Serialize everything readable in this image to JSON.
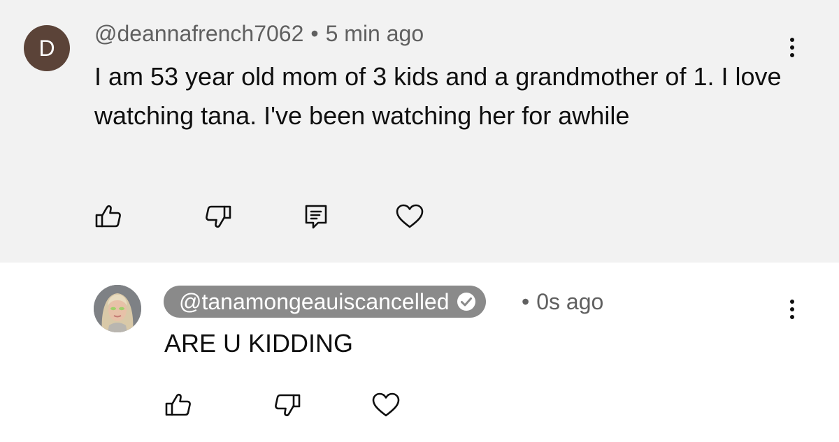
{
  "comment": {
    "avatar_letter": "D",
    "avatar_color": "#5b4338",
    "handle": "@deannafrench7062",
    "separator": "•",
    "time": "5 min ago",
    "text": "I am 53 year old mom of 3 kids and a grandmother of 1. I love watching tana. I've been watching her for awhile",
    "actions": [
      "like-icon",
      "dislike-icon",
      "reply-icon",
      "heart-icon"
    ],
    "background": "#f2f2f2"
  },
  "reply": {
    "handle": "@tanamongeauiscancelled",
    "verified": true,
    "chip_color": "#8a8a8a",
    "separator": "•",
    "time": "0s ago",
    "text": "ARE U KIDDING",
    "actions": [
      "like-icon",
      "dislike-icon",
      "heart-icon"
    ]
  }
}
